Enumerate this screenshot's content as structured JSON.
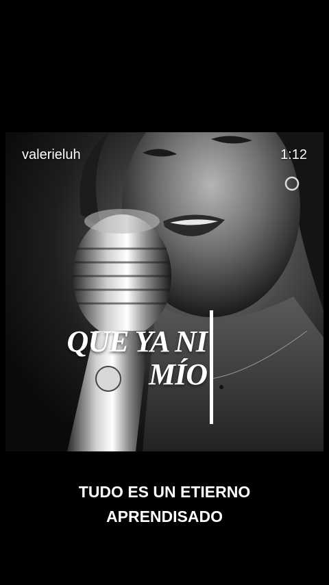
{
  "video": {
    "username": "valerieluh",
    "timestamp": "1:12",
    "lyric_lines": [
      "QUE YA NI",
      "MÍO"
    ]
  },
  "caption": {
    "lines": [
      "TUDO ES UN ETIERNO",
      "APRENDISADO"
    ]
  }
}
